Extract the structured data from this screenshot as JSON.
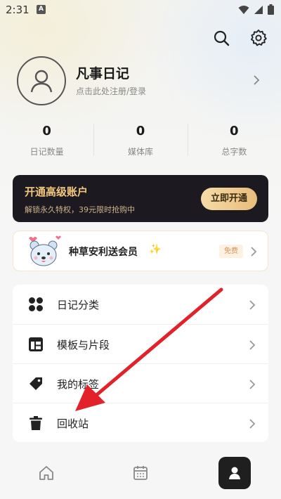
{
  "status_bar": {
    "time": "2:31",
    "notif_icon": "a-notification-icon"
  },
  "profile": {
    "name": "凡事日记",
    "subtitle": "点击此处注册/登录"
  },
  "stats": [
    {
      "value": "0",
      "label": "日记数量"
    },
    {
      "value": "0",
      "label": "媒体库"
    },
    {
      "value": "0",
      "label": "总字数"
    }
  ],
  "premium": {
    "title": "开通高级账户",
    "subtitle": "解锁永久特权，39元限时抢购中",
    "button": "立即开通",
    "accent": "#f0c77d"
  },
  "promo": {
    "text": "种草安利送会员",
    "badge": "免费"
  },
  "menu": [
    {
      "label": "日记分类",
      "icon": "category-grid-icon"
    },
    {
      "label": "模板与片段",
      "icon": "template-layout-icon"
    },
    {
      "label": "我的标签",
      "icon": "tag-icon"
    },
    {
      "label": "回收站",
      "icon": "trash-icon"
    }
  ],
  "nav": {
    "items": [
      "home-icon",
      "calendar-icon",
      "profile-icon"
    ],
    "active": "profile-icon"
  },
  "colors": {
    "annotation_arrow": "#e3212a",
    "dark_banner": "#1c1a20"
  }
}
